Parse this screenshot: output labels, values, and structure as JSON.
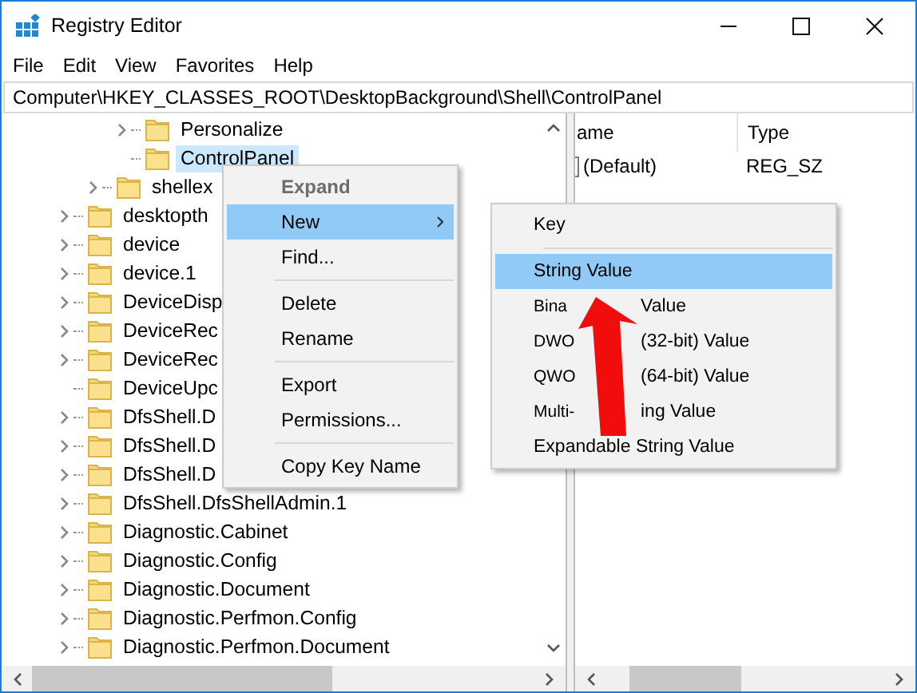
{
  "window": {
    "title": "Registry Editor"
  },
  "menu_bar": [
    "File",
    "Edit",
    "View",
    "Favorites",
    "Help"
  ],
  "address": {
    "value": "Computer\\HKEY_CLASSES_ROOT\\DesktopBackground\\Shell\\ControlPanel"
  },
  "tree": {
    "items": [
      {
        "children": [
          {
            "children": [
              {
                "label": "Personalize",
                "expandable": true,
                "selected": false
              },
              {
                "label": "ControlPanel",
                "expandable": false,
                "selected": true
              }
            ]
          },
          {
            "label": "shellex",
            "expandable": true,
            "selected": false
          }
        ]
      },
      {
        "label": "desktopth",
        "expandable": true,
        "selected": false
      },
      {
        "label": "device",
        "expandable": true,
        "selected": false
      },
      {
        "label": "device.1",
        "expandable": true,
        "selected": false
      },
      {
        "label": "DeviceDisp",
        "expandable": true,
        "selected": false
      },
      {
        "label": "DeviceRec",
        "expandable": true,
        "selected": false
      },
      {
        "label": "DeviceRec",
        "expandable": true,
        "selected": false
      },
      {
        "label": "DeviceUpc",
        "expandable": false,
        "selected": false
      },
      {
        "label": "DfsShell.D",
        "expandable": true,
        "selected": false
      },
      {
        "label": "DfsShell.D",
        "expandable": true,
        "selected": false
      },
      {
        "label": "DfsShell.D",
        "expandable": true,
        "selected": false
      },
      {
        "label": "DfsShell.DfsShellAdmin.1",
        "expandable": true,
        "selected": false
      },
      {
        "label": "Diagnostic.Cabinet",
        "expandable": true,
        "selected": false
      },
      {
        "label": "Diagnostic.Config",
        "expandable": true,
        "selected": false
      },
      {
        "label": "Diagnostic.Document",
        "expandable": true,
        "selected": false
      },
      {
        "label": "Diagnostic.Perfmon.Config",
        "expandable": true,
        "selected": false
      },
      {
        "label": "Diagnostic.Perfmon.Document",
        "expandable": true,
        "selected": false
      }
    ]
  },
  "values": {
    "columns": [
      "ame",
      "Type"
    ],
    "rows": [
      {
        "cells": [
          "(Default)",
          "REG_SZ"
        ]
      }
    ]
  },
  "context_menu": {
    "items": [
      {
        "kind": "item",
        "label": "Expand",
        "disabled": true,
        "default": true,
        "selected": false,
        "submenu": false
      },
      {
        "kind": "item",
        "label": "New",
        "disabled": false,
        "default": false,
        "selected": true,
        "submenu": true
      },
      {
        "kind": "item",
        "label": "Find...",
        "disabled": false,
        "default": false,
        "selected": false,
        "submenu": false
      },
      {
        "kind": "separator"
      },
      {
        "kind": "item",
        "label": "Delete",
        "disabled": false,
        "default": false,
        "selected": false,
        "submenu": false
      },
      {
        "kind": "item",
        "label": "Rename",
        "disabled": false,
        "default": false,
        "selected": false,
        "submenu": false
      },
      {
        "kind": "separator"
      },
      {
        "kind": "item",
        "label": "Export",
        "disabled": false,
        "default": false,
        "selected": false,
        "submenu": false
      },
      {
        "kind": "item",
        "label": "Permissions...",
        "disabled": false,
        "default": false,
        "selected": false,
        "submenu": false
      },
      {
        "kind": "separator"
      },
      {
        "kind": "item",
        "label": "Copy Key Name",
        "disabled": false,
        "default": false,
        "selected": false,
        "submenu": false
      }
    ]
  },
  "submenu": {
    "items": [
      {
        "kind": "item",
        "parts": [
          "Key"
        ],
        "selected": false
      },
      {
        "kind": "separator"
      },
      {
        "kind": "item",
        "parts": [
          "String Value"
        ],
        "selected": true
      },
      {
        "kind": "item",
        "parts": [
          "Bina",
          "Value"
        ],
        "selected": false
      },
      {
        "kind": "item",
        "parts": [
          "DWO",
          "(32-bit) Value"
        ],
        "selected": false
      },
      {
        "kind": "item",
        "parts": [
          "QWO",
          "(64-bit) Value"
        ],
        "selected": false
      },
      {
        "kind": "item",
        "parts": [
          "Multi-",
          "ing Value"
        ],
        "selected": false
      },
      {
        "kind": "item",
        "parts": [
          "Expandable String Value"
        ],
        "selected": false
      }
    ]
  }
}
